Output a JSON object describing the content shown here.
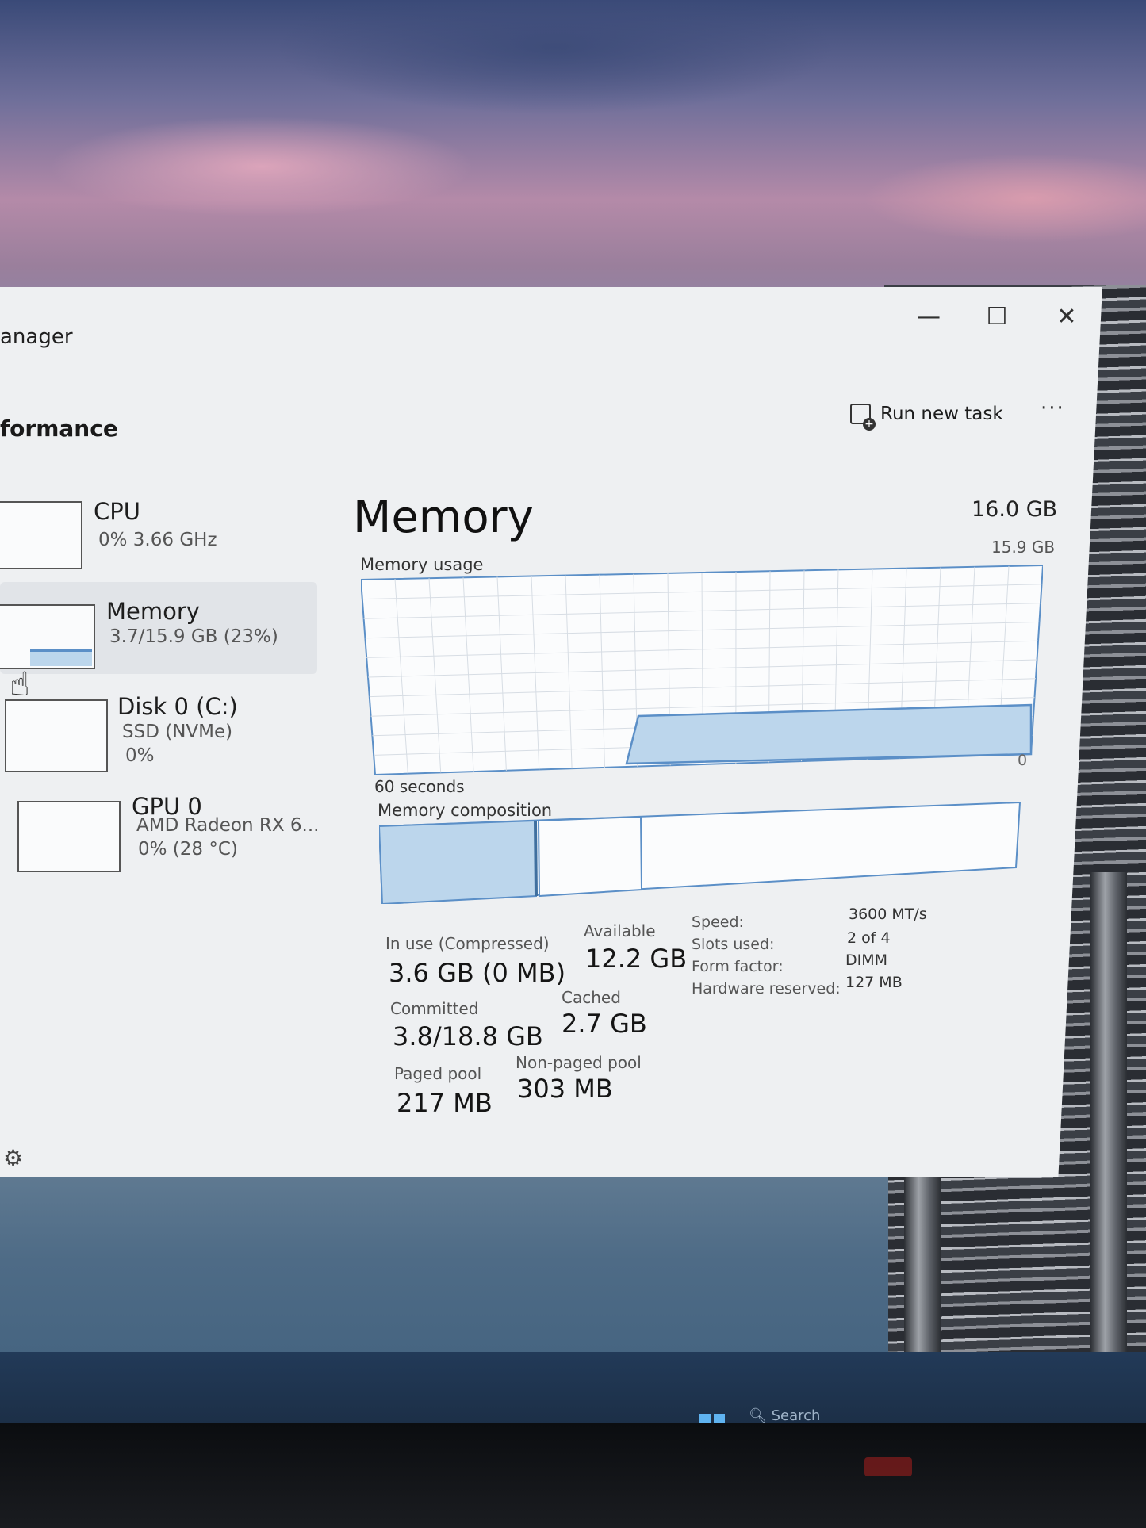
{
  "window": {
    "title": "anager",
    "minimize": "—",
    "maximize": "☐",
    "close": "✕"
  },
  "header": {
    "page_title": "formance",
    "run_new_task": "Run new task",
    "more": "···"
  },
  "sidebar": {
    "items": [
      {
        "name": "CPU",
        "sub1": "0%  3.66 GHz",
        "sub2": "",
        "sub3": ""
      },
      {
        "name": "Memory",
        "sub1": "3.7/15.9 GB (23%)",
        "sub2": "",
        "sub3": ""
      },
      {
        "name": "Disk 0 (C:)",
        "sub1": "SSD (NVMe)",
        "sub2": "0%",
        "sub3": ""
      },
      {
        "name": "GPU 0",
        "sub1": "AMD Radeon RX 6...",
        "sub2": "0%  (28 °C)",
        "sub3": ""
      }
    ],
    "memory_usage_fraction": 0.23
  },
  "memory": {
    "title": "Memory",
    "total": "16.0 GB",
    "max_label": "15.9 GB",
    "usage_label": "Memory usage",
    "zero_label": "0",
    "seconds_label": "60 seconds",
    "composition_label": "Memory composition",
    "stats": {
      "in_use_label": "In use (Compressed)",
      "in_use_value": "3.6 GB (0 MB)",
      "available_label": "Available",
      "available_value": "12.2 GB",
      "committed_label": "Committed",
      "committed_value": "3.8/18.8 GB",
      "cached_label": "Cached",
      "cached_value": "2.7 GB",
      "paged_label": "Paged pool",
      "paged_value": "217 MB",
      "nonpaged_label": "Non-paged pool",
      "nonpaged_value": "303 MB"
    },
    "specs": {
      "speed_label": "Speed:",
      "speed_value": "3600 MT/s",
      "slots_label": "Slots used:",
      "slots_value": "2 of 4",
      "form_label": "Form factor:",
      "form_value": "DIMM",
      "reserved_label": "Hardware reserved:",
      "reserved_value": "127 MB"
    }
  },
  "taskbar": {
    "search_placeholder": "Search"
  },
  "colors": {
    "graph_line": "#5b8fc7",
    "graph_fill": "#bcd6ec",
    "grid": "#d7dde4"
  }
}
